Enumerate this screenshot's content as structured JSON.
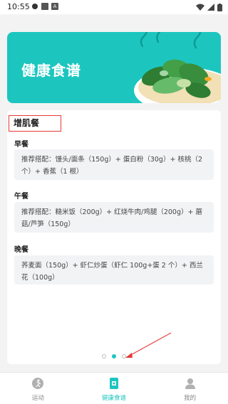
{
  "status_bar": {
    "time": "10:55",
    "a_badge": "A"
  },
  "banner": {
    "title": "健康食谱"
  },
  "section": {
    "title": "增肌餐"
  },
  "meals": [
    {
      "name": "早餐",
      "text": "推荐搭配：馒头/面条（150g）+ 蛋白粉（30g）+ 核桃（2 个）+ 香蕉（1 根）"
    },
    {
      "name": "午餐",
      "text": "推荐搭配：糙米饭（200g）+ 红烧牛肉/鸡腿（200g）+ 蘑菇/芦笋（150g）"
    },
    {
      "name": "晚餐",
      "text": "荞麦面（150g）+ 虾仁炒蛋（虾仁 100g+蛋 2 个）+ 西兰花（100g）"
    }
  ],
  "pager": {
    "count": 3,
    "active_index": 1
  },
  "nav": [
    {
      "label": "运动",
      "icon": "run-icon"
    },
    {
      "label": "健康食谱",
      "icon": "recipe-book-icon"
    },
    {
      "label": "我的",
      "icon": "profile-icon"
    }
  ],
  "colors": {
    "accent": "#1cc6bf",
    "highlight_border": "#e53935"
  }
}
